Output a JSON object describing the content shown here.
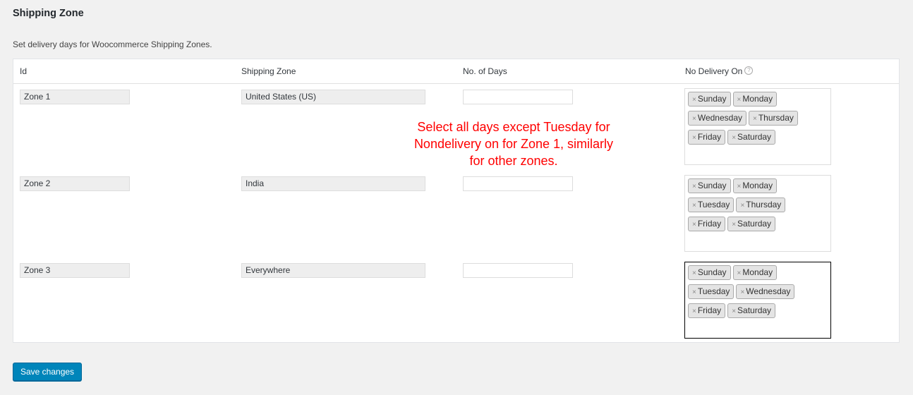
{
  "page": {
    "title": "Shipping Zone",
    "description": "Set delivery days for Woocommerce Shipping Zones."
  },
  "table": {
    "headers": [
      "Id",
      "Shipping Zone",
      "No. of Days",
      "No Delivery On"
    ],
    "help_icon": "question-circle-icon",
    "rows": [
      {
        "id": "Zone 1",
        "zone": "United States (US)",
        "days": "",
        "no_delivery": [
          "Sunday",
          "Monday",
          "Wednesday",
          "Thursday",
          "Friday",
          "Saturday"
        ]
      },
      {
        "id": "Zone 2",
        "zone": "India",
        "days": "",
        "no_delivery": [
          "Sunday",
          "Monday",
          "Tuesday",
          "Thursday",
          "Friday",
          "Saturday"
        ]
      },
      {
        "id": "Zone 3",
        "zone": "Everywhere",
        "days": "",
        "no_delivery": [
          "Sunday",
          "Monday",
          "Tuesday",
          "Wednesday",
          "Friday",
          "Saturday"
        ]
      }
    ],
    "remove_glyph": "×"
  },
  "annotation": {
    "text": "Select all days except Tuesday for Nondelivery on for Zone 1, similarly for other zones.",
    "color": "#ff0000"
  },
  "save_button": {
    "label": "Save changes",
    "color": "#0085ba"
  }
}
